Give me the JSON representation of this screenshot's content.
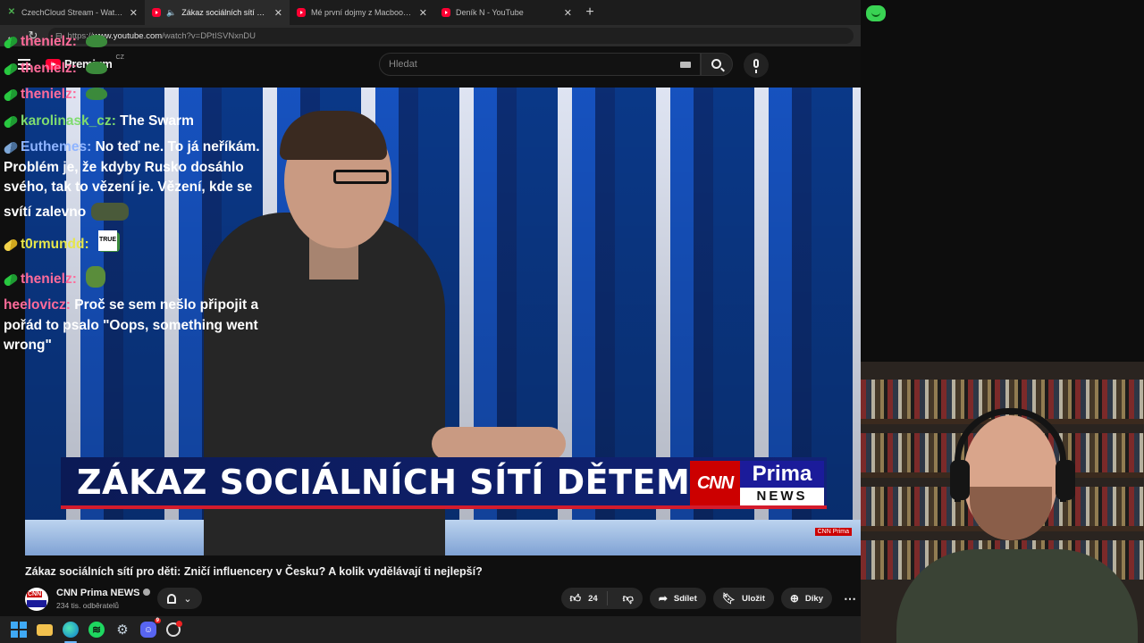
{
  "browser": {
    "tabs": [
      {
        "title": "CzechCloud Stream - Watch Live o",
        "active": false,
        "favicon": "czechcloud-icon"
      },
      {
        "title": "Zákaz sociálních sítí pro děti:",
        "active": true,
        "favicon": "youtube-icon"
      },
      {
        "title": "Mé první dojmy z Macbook Neo.",
        "active": false,
        "favicon": "youtube-icon"
      },
      {
        "title": "Deník N - YouTube",
        "active": false,
        "favicon": "youtube-icon"
      }
    ],
    "url_prefix": "https://",
    "url_host": "www.youtube.com",
    "url_path": "/watch?v=DPtISVNxnDU"
  },
  "youtube": {
    "logo_text": "Premium",
    "logo_region": "CZ",
    "search_placeholder": "Hledat"
  },
  "video": {
    "lower_third": "ZÁKAZ SOCIÁLNÍCH SÍTÍ DĚTEM?",
    "brand_cnn": "CNN",
    "brand_prima": "Prima",
    "brand_news": "NEWS",
    "bug": "CNN Prima",
    "title": "Zákaz sociálních sítí pro děti: Zničí influencery v Česku? A kolik vydělávají ti nejlepší?"
  },
  "channel": {
    "name": "CNN Prima NEWS",
    "subscribers": "234 tis. odběratelů"
  },
  "actions": {
    "likes": "24",
    "share": "Sdílet",
    "save": "Uložit",
    "thanks": "Díky"
  },
  "chat": [
    {
      "user": "thenielz",
      "color": "#ff6b9a",
      "badge": "pill-green",
      "text": "",
      "emote": "pepe"
    },
    {
      "user": "thenielz",
      "color": "#ff6b9a",
      "badge": "pill-green",
      "text": "",
      "emote": "pepe"
    },
    {
      "user": "thenielz",
      "color": "#ff6b9a",
      "badge": "pill-green",
      "text": "",
      "emote": "pepe"
    },
    {
      "user": "karolinask_cz",
      "color": "#7fdc6f",
      "badge": "pill-green",
      "text": "The Swarm",
      "emote": ""
    },
    {
      "user": "Euthemes",
      "color": "#8fb4ff",
      "badge": "pill-blue",
      "text": "No teď ne. To já neříkám. Problém je, že kdyby Rusko dosáhlo svého, tak to vězení je. Vězení, kde se svítí zalevno",
      "emote": "pepe2"
    },
    {
      "user": "t0rmundd",
      "color": "#e6e64a",
      "badge": "pill-yellow",
      "text": "",
      "emote": "truepepe"
    },
    {
      "user": "thenielz",
      "color": "#ff6b9a",
      "badge": "pill-green",
      "text": "",
      "emote": "sip"
    },
    {
      "user": "heelovicz",
      "color": "#ff6b9a",
      "badge": "",
      "text": "Proč se sem nešlo připojit a pořád to psalo \"Oops, something went wrong\"",
      "emote": ""
    }
  ]
}
